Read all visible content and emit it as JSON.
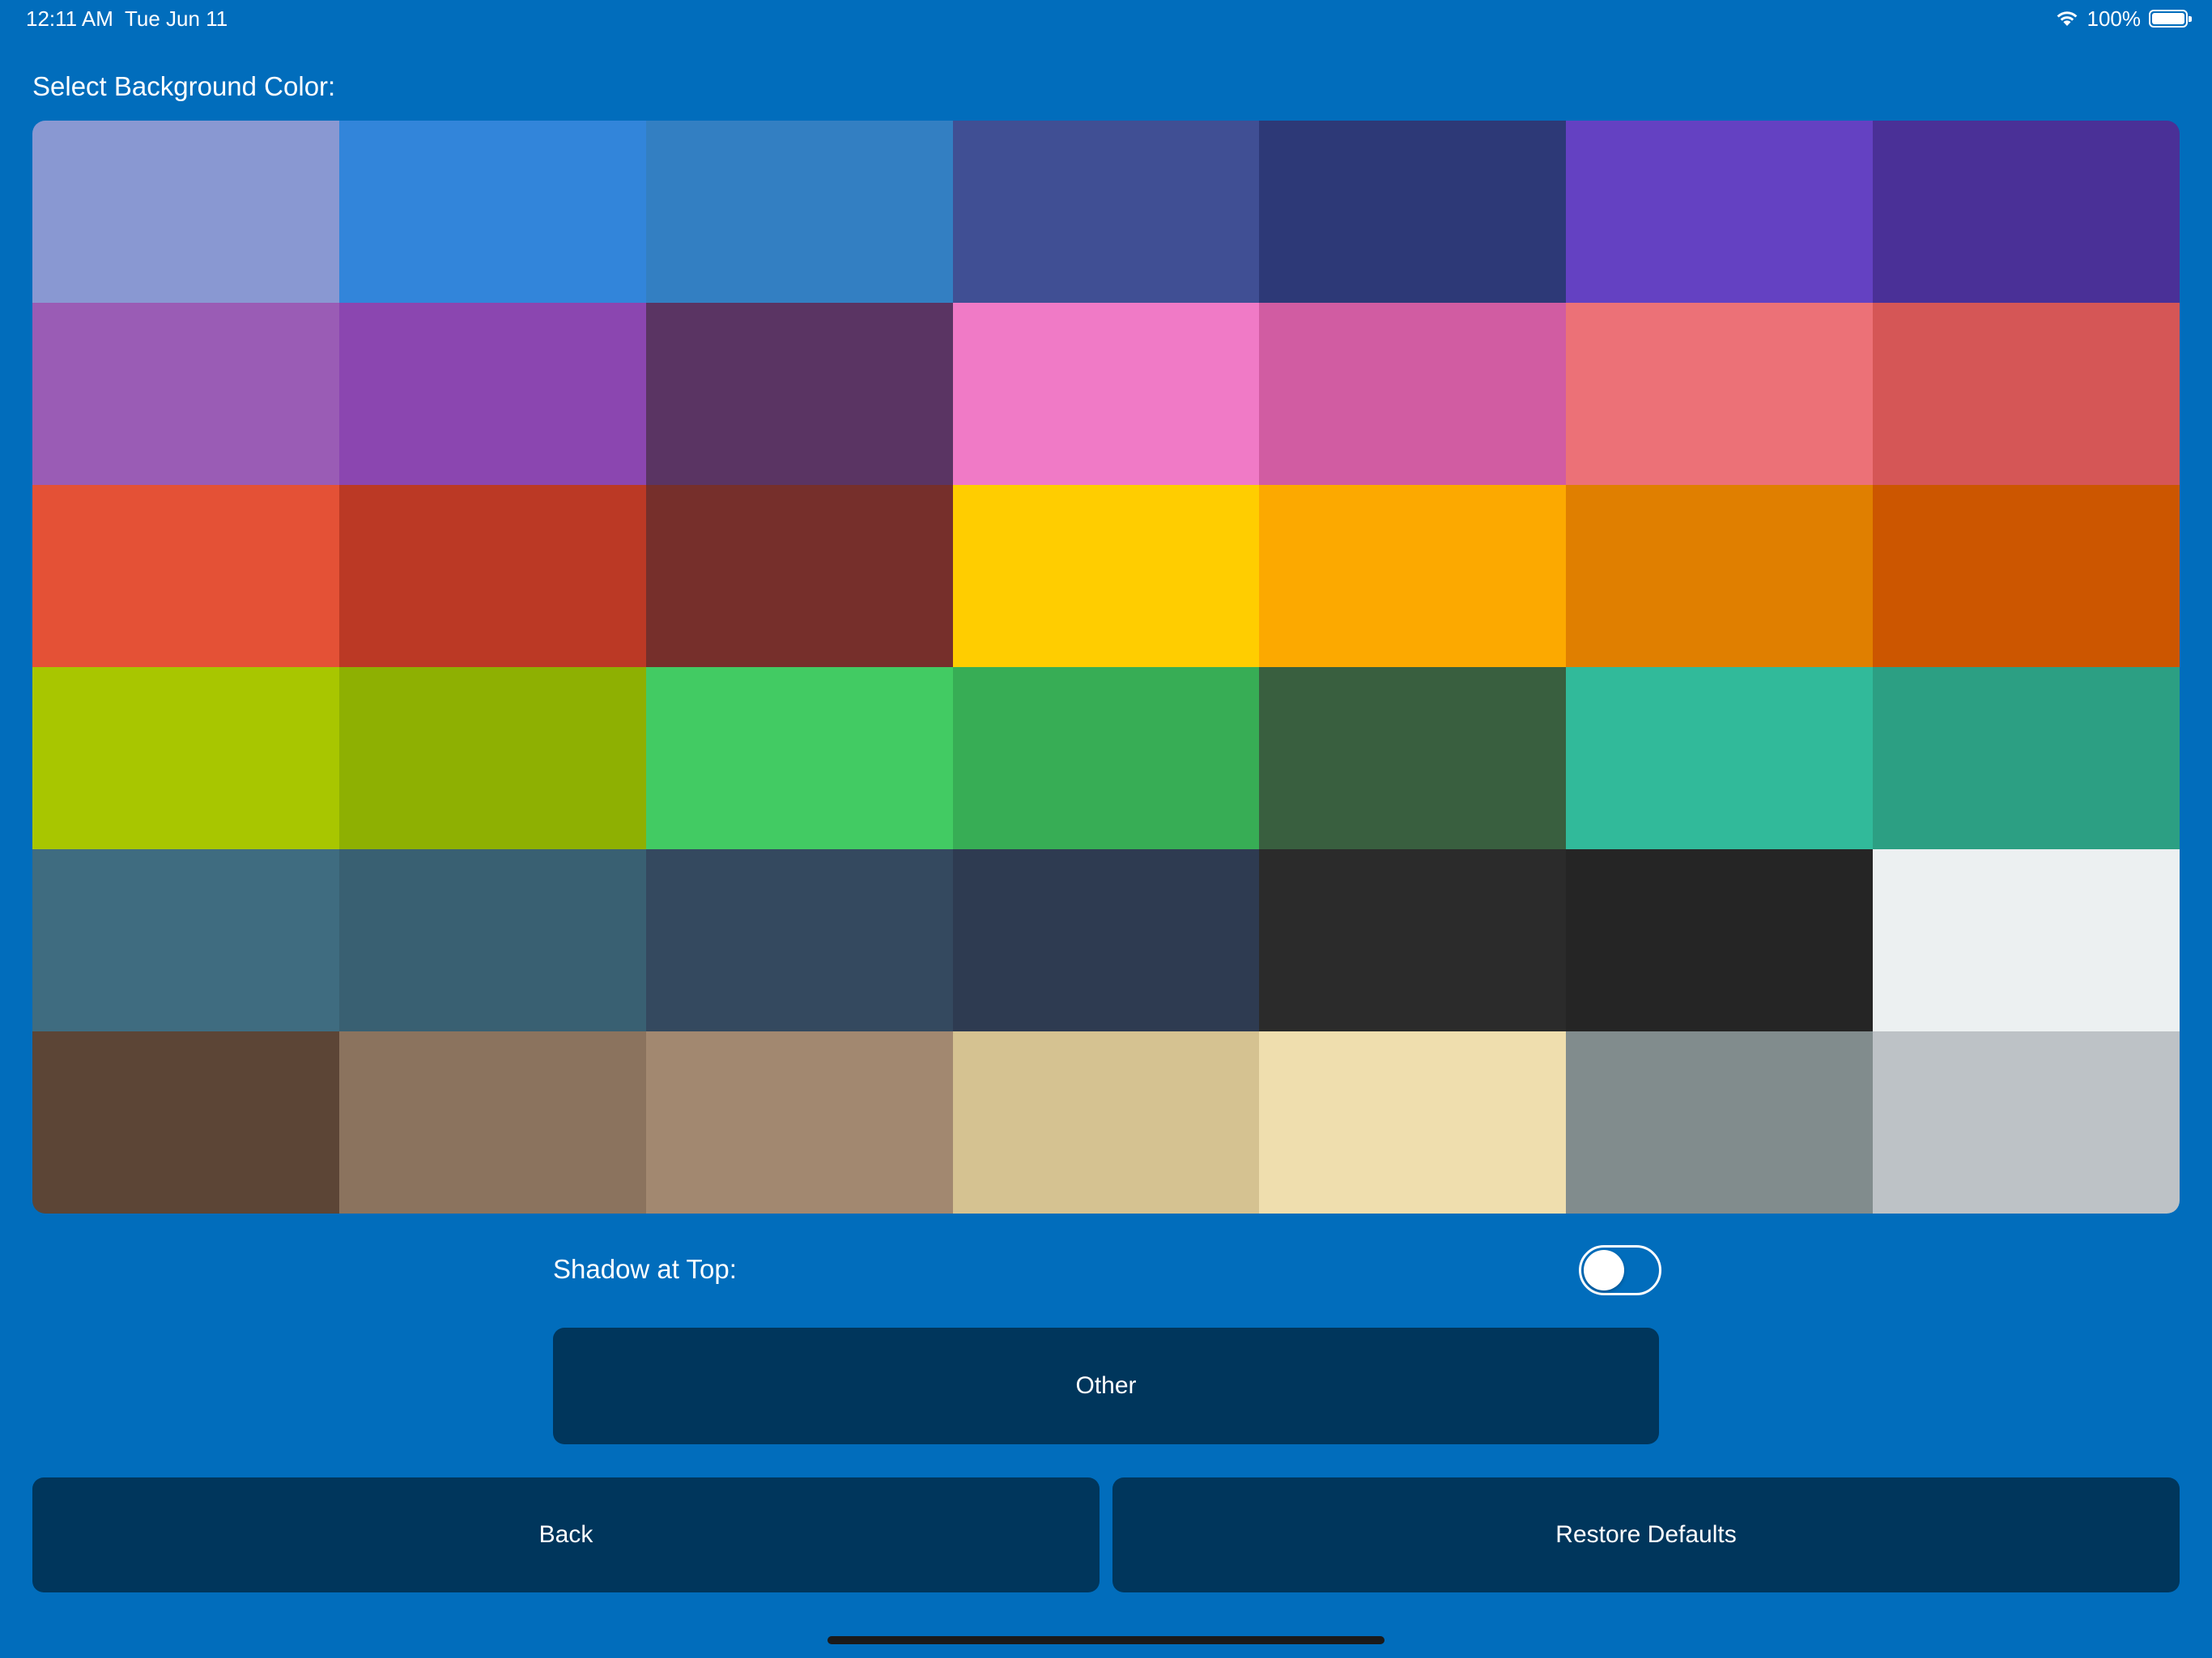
{
  "status_bar": {
    "time": "12:11 AM",
    "date": "Tue Jun 11",
    "battery_text": "100%",
    "wifi_icon": "wifi-icon",
    "battery_icon": "battery-full-icon"
  },
  "screen": {
    "background_color": "#016dbc",
    "section_label": "Select Background Color:"
  },
  "color_grid": {
    "swatches": [
      "#8998d2",
      "#3285da",
      "#337fc2",
      "#404f94",
      "#2d3977",
      "#6441c2",
      "#4a3097",
      "#9a5cb5",
      "#8b46b0",
      "#5a3463",
      "#f07ac6",
      "#d15ca2",
      "#ec7177",
      "#d55656",
      "#e45136",
      "#bb3925",
      "#762f2b",
      "#ffcd00",
      "#fca900",
      "#e07f00",
      "#cc5600",
      "#a8c600",
      "#8eb002",
      "#42cb63",
      "#37ad55",
      "#395f3f",
      "#31ba9a",
      "#2c9f83",
      "#3f6c80",
      "#396072",
      "#34495f",
      "#2e3b51",
      "#2b2b2b",
      "#252525",
      "#ecf0f1",
      "#5c4536",
      "#8b735e",
      "#a28870",
      "#d5c291",
      "#efdeae",
      "#818c8d",
      "#bdc2c6"
    ]
  },
  "shadow_setting": {
    "label": "Shadow at Top:",
    "enabled": false
  },
  "buttons": {
    "other": "Other",
    "back": "Back",
    "restore_defaults": "Restore Defaults",
    "button_color": "#00365c"
  }
}
